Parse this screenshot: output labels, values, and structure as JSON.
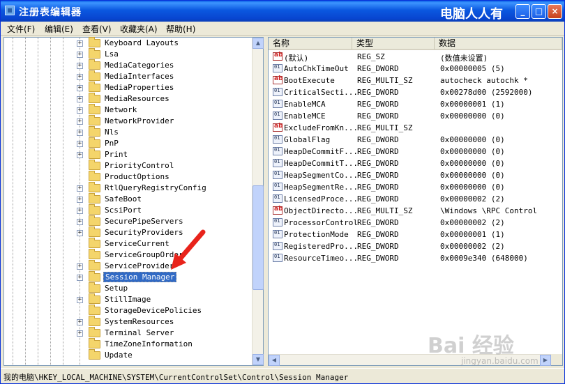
{
  "window": {
    "title": "注册表编辑器",
    "watermark": "电脑人人有",
    "buttons": {
      "minimize": "_",
      "maximize": "□",
      "close": "×"
    }
  },
  "menu": [
    {
      "label": "文件(F)"
    },
    {
      "label": "编辑(E)"
    },
    {
      "label": "查看(V)"
    },
    {
      "label": "收藏夹(A)"
    },
    {
      "label": "帮助(H)"
    }
  ],
  "tree": {
    "items": [
      {
        "label": "Keyboard Layouts",
        "expander": "+",
        "selected": false
      },
      {
        "label": "Lsa",
        "expander": "+",
        "selected": false
      },
      {
        "label": "MediaCategories",
        "expander": "+",
        "selected": false
      },
      {
        "label": "MediaInterfaces",
        "expander": "+",
        "selected": false
      },
      {
        "label": "MediaProperties",
        "expander": "+",
        "selected": false
      },
      {
        "label": "MediaResources",
        "expander": "+",
        "selected": false
      },
      {
        "label": "Network",
        "expander": "+",
        "selected": false
      },
      {
        "label": "NetworkProvider",
        "expander": "+",
        "selected": false
      },
      {
        "label": "Nls",
        "expander": "+",
        "selected": false
      },
      {
        "label": "PnP",
        "expander": "+",
        "selected": false
      },
      {
        "label": "Print",
        "expander": "+",
        "selected": false
      },
      {
        "label": "PriorityControl",
        "expander": "",
        "selected": false
      },
      {
        "label": "ProductOptions",
        "expander": "",
        "selected": false
      },
      {
        "label": "RtlQueryRegistryConfig",
        "expander": "+",
        "selected": false
      },
      {
        "label": "SafeBoot",
        "expander": "+",
        "selected": false
      },
      {
        "label": "ScsiPort",
        "expander": "+",
        "selected": false
      },
      {
        "label": "SecurePipeServers",
        "expander": "+",
        "selected": false
      },
      {
        "label": "SecurityProviders",
        "expander": "+",
        "selected": false
      },
      {
        "label": "ServiceCurrent",
        "expander": "",
        "selected": false
      },
      {
        "label": "ServiceGroupOrder",
        "expander": "",
        "selected": false
      },
      {
        "label": "ServiceProvider",
        "expander": "+",
        "selected": false
      },
      {
        "label": "Session Manager",
        "expander": "+",
        "selected": true
      },
      {
        "label": "Setup",
        "expander": "",
        "selected": false
      },
      {
        "label": "StillImage",
        "expander": "+",
        "selected": false
      },
      {
        "label": "StorageDevicePolicies",
        "expander": "",
        "selected": false
      },
      {
        "label": "SystemResources",
        "expander": "+",
        "selected": false
      },
      {
        "label": "Terminal Server",
        "expander": "+",
        "selected": false
      },
      {
        "label": "TimeZoneInformation",
        "expander": "",
        "selected": false
      },
      {
        "label": "Update",
        "expander": "",
        "selected": false
      }
    ]
  },
  "values": {
    "headers": {
      "name": "名称",
      "type": "类型",
      "data": "数据"
    },
    "rows": [
      {
        "icon": "string-value-icon",
        "name": "(默认)",
        "type": "REG_SZ",
        "data": "(数值未设置)"
      },
      {
        "icon": "binary-value-icon",
        "name": "AutoChkTimeOut",
        "type": "REG_DWORD",
        "data": "0x00000005 (5)"
      },
      {
        "icon": "string-value-icon",
        "name": "BootExecute",
        "type": "REG_MULTI_SZ",
        "data": "autocheck autochk *"
      },
      {
        "icon": "binary-value-icon",
        "name": "CriticalSecti...",
        "type": "REG_DWORD",
        "data": "0x00278d00 (2592000)"
      },
      {
        "icon": "binary-value-icon",
        "name": "EnableMCA",
        "type": "REG_DWORD",
        "data": "0x00000001 (1)"
      },
      {
        "icon": "binary-value-icon",
        "name": "EnableMCE",
        "type": "REG_DWORD",
        "data": "0x00000000 (0)"
      },
      {
        "icon": "string-value-icon",
        "name": "ExcludeFromKn...",
        "type": "REG_MULTI_SZ",
        "data": ""
      },
      {
        "icon": "binary-value-icon",
        "name": "GlobalFlag",
        "type": "REG_DWORD",
        "data": "0x00000000 (0)"
      },
      {
        "icon": "binary-value-icon",
        "name": "HeapDeCommitF...",
        "type": "REG_DWORD",
        "data": "0x00000000 (0)"
      },
      {
        "icon": "binary-value-icon",
        "name": "HeapDeCommitT...",
        "type": "REG_DWORD",
        "data": "0x00000000 (0)"
      },
      {
        "icon": "binary-value-icon",
        "name": "HeapSegmentCo...",
        "type": "REG_DWORD",
        "data": "0x00000000 (0)"
      },
      {
        "icon": "binary-value-icon",
        "name": "HeapSegmentRe...",
        "type": "REG_DWORD",
        "data": "0x00000000 (0)"
      },
      {
        "icon": "binary-value-icon",
        "name": "LicensedProce...",
        "type": "REG_DWORD",
        "data": "0x00000002 (2)"
      },
      {
        "icon": "string-value-icon",
        "name": "ObjectDirecto...",
        "type": "REG_MULTI_SZ",
        "data": "\\Windows \\RPC Control"
      },
      {
        "icon": "binary-value-icon",
        "name": "ProcessorControl",
        "type": "REG_DWORD",
        "data": "0x00000002 (2)"
      },
      {
        "icon": "binary-value-icon",
        "name": "ProtectionMode",
        "type": "REG_DWORD",
        "data": "0x00000001 (1)"
      },
      {
        "icon": "binary-value-icon",
        "name": "RegisteredPro...",
        "type": "REG_DWORD",
        "data": "0x00000002 (2)"
      },
      {
        "icon": "binary-value-icon",
        "name": "ResourceTimeo...",
        "type": "REG_DWORD",
        "data": "0x0009e340 (648000)"
      }
    ]
  },
  "status": {
    "path": "我的电脑\\HKEY_LOCAL_MACHINE\\SYSTEM\\CurrentControlSet\\Control\\Session Manager"
  },
  "overlay": {
    "brand": "Bai 经验",
    "url": "jingyan.baidu.com"
  },
  "colors": {
    "selection": "#316ac5",
    "titlebar": "#0a5fe6",
    "arrow": "#e8231b"
  }
}
